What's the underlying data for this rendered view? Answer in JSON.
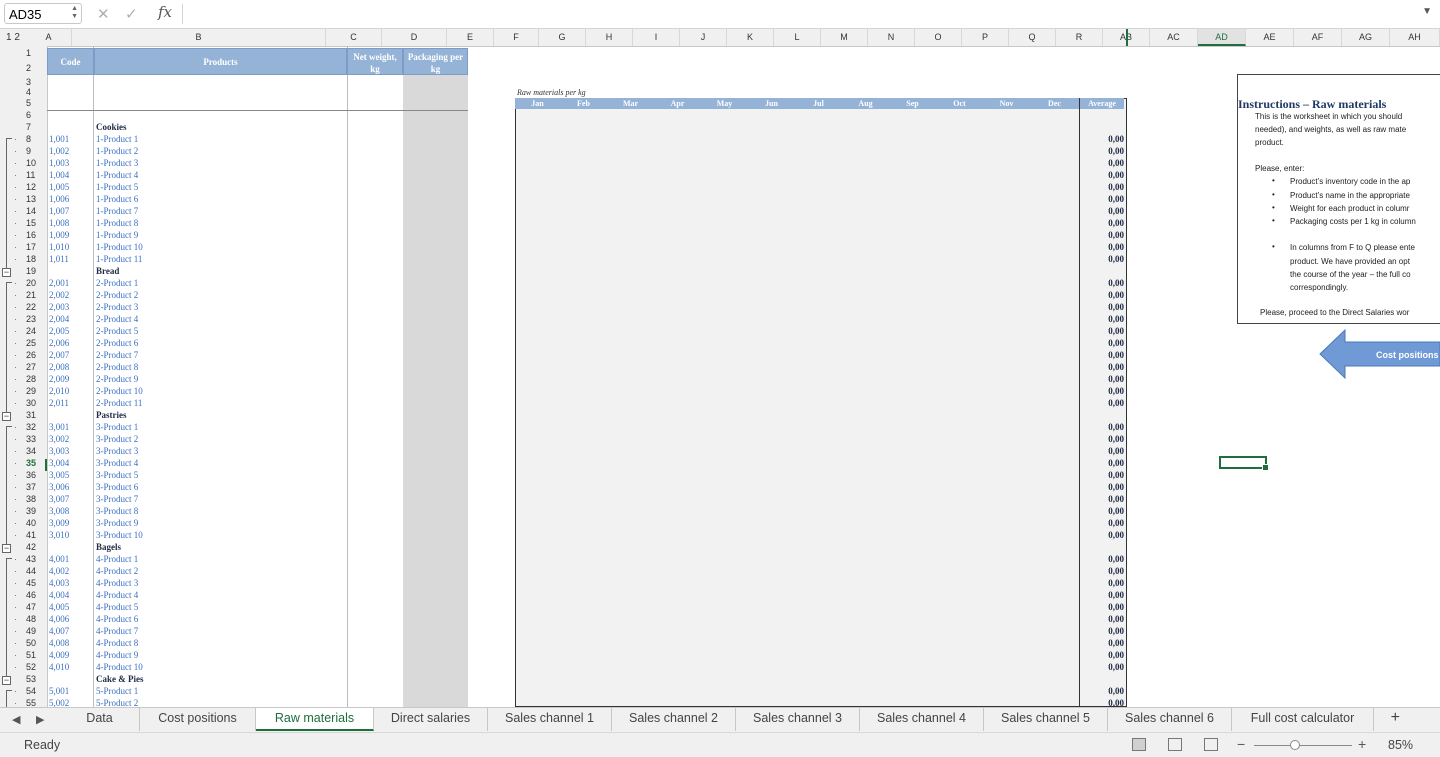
{
  "formula_bar": {
    "name_box": "AD35",
    "cancel_glyph": "✕",
    "enter_glyph": "✓",
    "fx_label": "fx",
    "formula": ""
  },
  "outline_levels": [
    "1",
    "2"
  ],
  "columns": [
    "A",
    "B",
    "C",
    "D",
    "E",
    "F",
    "G",
    "H",
    "I",
    "J",
    "K",
    "L",
    "M",
    "N",
    "O",
    "P",
    "Q",
    "R",
    "AB",
    "AC",
    "AD",
    "AE",
    "AF",
    "AG",
    "AH"
  ],
  "selected_column": "AD",
  "selected_row": "35",
  "headers": {
    "code": "Code",
    "products": "Products",
    "net_weight": "Net weight, kg",
    "packaging": "Packaging per kg"
  },
  "raw_label": "Raw materials per kg",
  "months": [
    "Jan",
    "Feb",
    "Mar",
    "Apr",
    "May",
    "Jun",
    "Jul",
    "Aug",
    "Sep",
    "Oct",
    "Nov",
    "Dec"
  ],
  "average_label": "Average",
  "groups": [
    {
      "name": "Cookies",
      "header_row": "7",
      "items": [
        {
          "row": "8",
          "code": "1,001",
          "product": "1-Product 1",
          "avg": "0,00"
        },
        {
          "row": "9",
          "code": "1,002",
          "product": "1-Product 2",
          "avg": "0,00"
        },
        {
          "row": "10",
          "code": "1,003",
          "product": "1-Product 3",
          "avg": "0,00"
        },
        {
          "row": "11",
          "code": "1,004",
          "product": "1-Product 4",
          "avg": "0,00"
        },
        {
          "row": "12",
          "code": "1,005",
          "product": "1-Product 5",
          "avg": "0,00"
        },
        {
          "row": "13",
          "code": "1,006",
          "product": "1-Product 6",
          "avg": "0,00"
        },
        {
          "row": "14",
          "code": "1,007",
          "product": "1-Product 7",
          "avg": "0,00"
        },
        {
          "row": "15",
          "code": "1,008",
          "product": "1-Product 8",
          "avg": "0,00"
        },
        {
          "row": "16",
          "code": "1,009",
          "product": "1-Product 9",
          "avg": "0,00"
        },
        {
          "row": "17",
          "code": "1,010",
          "product": "1-Product 10",
          "avg": "0,00"
        },
        {
          "row": "18",
          "code": "1,011",
          "product": "1-Product 11",
          "avg": "0,00"
        }
      ]
    },
    {
      "name": "Bread",
      "header_row": "19",
      "items": [
        {
          "row": "20",
          "code": "2,001",
          "product": "2-Product 1",
          "avg": "0,00"
        },
        {
          "row": "21",
          "code": "2,002",
          "product": "2-Product 2",
          "avg": "0,00"
        },
        {
          "row": "22",
          "code": "2,003",
          "product": "2-Product 3",
          "avg": "0,00"
        },
        {
          "row": "23",
          "code": "2,004",
          "product": "2-Product 4",
          "avg": "0,00"
        },
        {
          "row": "24",
          "code": "2,005",
          "product": "2-Product 5",
          "avg": "0,00"
        },
        {
          "row": "25",
          "code": "2,006",
          "product": "2-Product 6",
          "avg": "0,00"
        },
        {
          "row": "26",
          "code": "2,007",
          "product": "2-Product 7",
          "avg": "0,00"
        },
        {
          "row": "27",
          "code": "2,008",
          "product": "2-Product 8",
          "avg": "0,00"
        },
        {
          "row": "28",
          "code": "2,009",
          "product": "2-Product 9",
          "avg": "0,00"
        },
        {
          "row": "29",
          "code": "2,010",
          "product": "2-Product 10",
          "avg": "0,00"
        },
        {
          "row": "30",
          "code": "2,011",
          "product": "2-Product 11",
          "avg": "0,00"
        }
      ]
    },
    {
      "name": "Pastries",
      "header_row": "31",
      "items": [
        {
          "row": "32",
          "code": "3,001",
          "product": "3-Product 1",
          "avg": "0,00"
        },
        {
          "row": "33",
          "code": "3,002",
          "product": "3-Product 2",
          "avg": "0,00"
        },
        {
          "row": "34",
          "code": "3,003",
          "product": "3-Product 3",
          "avg": "0,00"
        },
        {
          "row": "35",
          "code": "3,004",
          "product": "3-Product 4",
          "avg": "0,00"
        },
        {
          "row": "36",
          "code": "3,005",
          "product": "3-Product 5",
          "avg": "0,00"
        },
        {
          "row": "37",
          "code": "3,006",
          "product": "3-Product 6",
          "avg": "0,00"
        },
        {
          "row": "38",
          "code": "3,007",
          "product": "3-Product 7",
          "avg": "0,00"
        },
        {
          "row": "39",
          "code": "3,008",
          "product": "3-Product 8",
          "avg": "0,00"
        },
        {
          "row": "40",
          "code": "3,009",
          "product": "3-Product 9",
          "avg": "0,00"
        },
        {
          "row": "41",
          "code": "3,010",
          "product": "3-Product 10",
          "avg": "0,00"
        }
      ]
    },
    {
      "name": "Bagels",
      "header_row": "42",
      "items": [
        {
          "row": "43",
          "code": "4,001",
          "product": "4-Product 1",
          "avg": "0,00"
        },
        {
          "row": "44",
          "code": "4,002",
          "product": "4-Product 2",
          "avg": "0,00"
        },
        {
          "row": "45",
          "code": "4,003",
          "product": "4-Product 3",
          "avg": "0,00"
        },
        {
          "row": "46",
          "code": "4,004",
          "product": "4-Product 4",
          "avg": "0,00"
        },
        {
          "row": "47",
          "code": "4,005",
          "product": "4-Product 5",
          "avg": "0,00"
        },
        {
          "row": "48",
          "code": "4,006",
          "product": "4-Product 6",
          "avg": "0,00"
        },
        {
          "row": "49",
          "code": "4,007",
          "product": "4-Product 7",
          "avg": "0,00"
        },
        {
          "row": "50",
          "code": "4,008",
          "product": "4-Product 8",
          "avg": "0,00"
        },
        {
          "row": "51",
          "code": "4,009",
          "product": "4-Product 9",
          "avg": "0,00"
        },
        {
          "row": "52",
          "code": "4,010",
          "product": "4-Product 10",
          "avg": "0,00"
        }
      ]
    },
    {
      "name": "Cake & Pies",
      "header_row": "53",
      "items": [
        {
          "row": "54",
          "code": "5,001",
          "product": "5-Product 1",
          "avg": "0,00"
        },
        {
          "row": "55",
          "code": "5,002",
          "product": "5-Product 2",
          "avg": "0,00"
        }
      ]
    }
  ],
  "instructions": {
    "title": "Instructions – Raw materials",
    "lines": [
      "This is the worksheet in which you should",
      "needed), and weights, as well as raw mate",
      "product.",
      "Please, enter:"
    ],
    "bullets": [
      "Product’s inventory code in the ap",
      "Product’s name in the appropriate",
      "Weight for each product in columr",
      "Packaging costs per 1 kg in column"
    ],
    "bullet2_lines": [
      "In columns from F to Q please ente",
      "product. We have provided an opt",
      "the course of the year – the full co",
      "correspondingly."
    ],
    "footer": "Please, proceed to the Direct Salaries wor"
  },
  "arrow_button": {
    "label": "Cost positions",
    "fill": "#6f9ad6"
  },
  "tabs": [
    "Data",
    "Cost positions",
    "Raw materials",
    "Direct salaries",
    "Sales channel 1",
    "Sales channel 2",
    "Sales channel 3",
    "Sales channel 4",
    "Sales channel 5",
    "Sales channel 6",
    "Full cost calculator"
  ],
  "active_tab": "Raw materials",
  "add_sheet": "+",
  "status": {
    "ready": "Ready",
    "zoom": "85%",
    "zoom_minus": "−",
    "zoom_plus": "+"
  },
  "colors": {
    "accent": "#1e6e3e",
    "header_blue": "#95b3d7",
    "code_blue": "#3a6fc2"
  }
}
